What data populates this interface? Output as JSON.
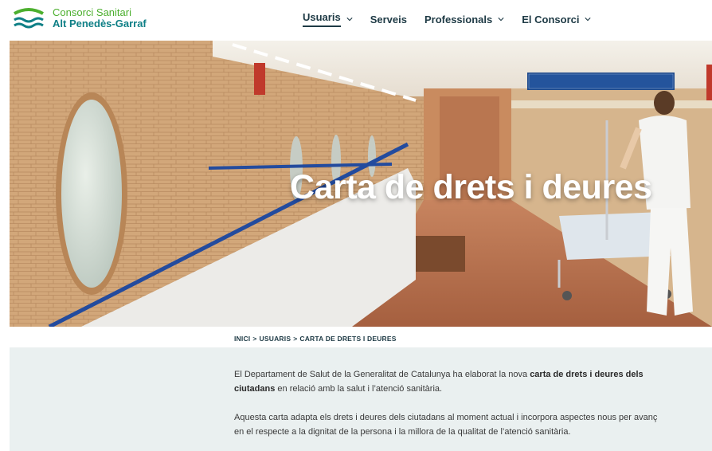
{
  "brand": {
    "line1": "Consorci Sanitari",
    "line2": "Alt Penedès-Garraf",
    "colors": {
      "green": "#4caf2e",
      "teal": "#0e7f86"
    }
  },
  "nav": {
    "items": [
      {
        "label": "Usuaris",
        "has_dropdown": true,
        "active": true
      },
      {
        "label": "Serveis",
        "has_dropdown": false,
        "active": false
      },
      {
        "label": "Professionals",
        "has_dropdown": true,
        "active": false
      },
      {
        "label": "El Consorci",
        "has_dropdown": true,
        "active": false
      }
    ]
  },
  "hero": {
    "title": "Carta de drets i deures"
  },
  "breadcrumb": {
    "items": [
      "INICI",
      "USUARIS",
      "CARTA DE DRETS I DEURES"
    ],
    "separator": ">"
  },
  "content": {
    "p1": {
      "pre": "El Departament de Salut de la Generalitat de Catalunya ha elaborat la nova ",
      "bold_line1": "carta de drets i deures dels",
      "bold_line2": "ciutadans",
      "post": " en relació amb la salut i l’atenció sanitària."
    },
    "p2": {
      "line1": "Aquesta carta adapta els drets i deures dels ciutadans al moment actual i incorpora aspectes nous per avanç",
      "line2": "en el respecte a la dignitat de la persona i la millora de la qualitat de l’atenció sanitària."
    }
  }
}
